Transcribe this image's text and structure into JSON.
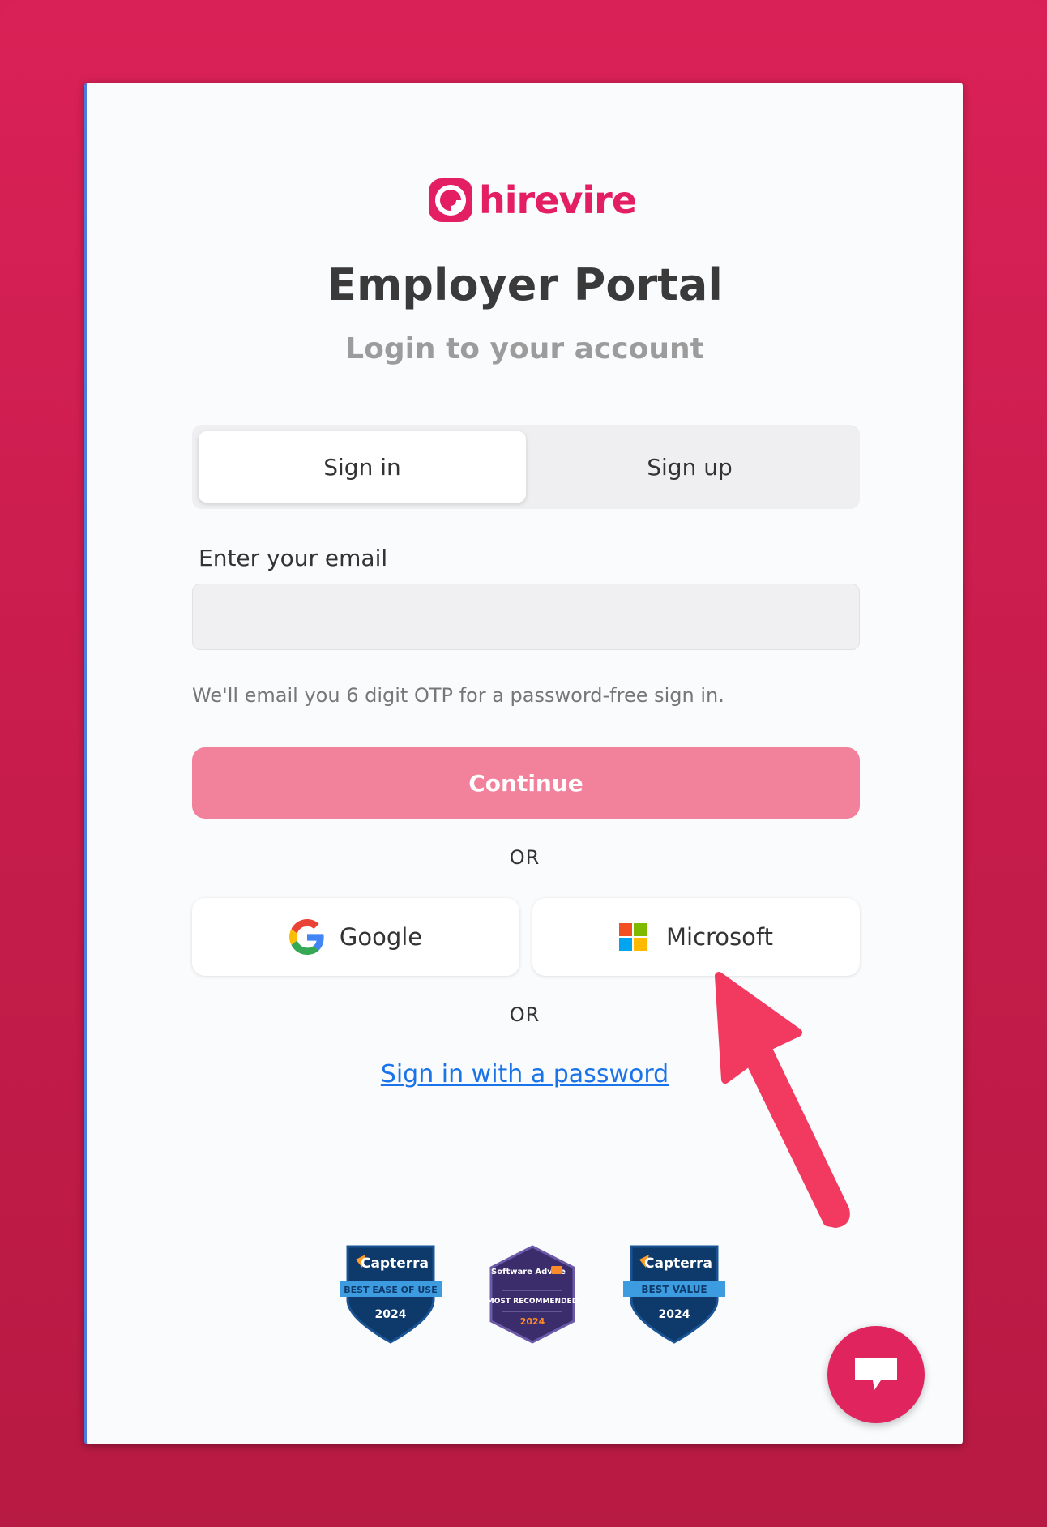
{
  "brand": {
    "name": "hirevire",
    "accent_color": "#e41e63",
    "logo_icon": "hirevire-logo-icon"
  },
  "header": {
    "title": "Employer Portal",
    "subtitle": "Login to your account"
  },
  "tabs": [
    {
      "label": "Sign in",
      "active": true
    },
    {
      "label": "Sign up",
      "active": false
    }
  ],
  "email": {
    "label": "Enter your email",
    "value": "",
    "placeholder": "",
    "hint": "We'll email you 6 digit OTP for a password-free sign in."
  },
  "continue_label": "Continue",
  "divider_text": "OR",
  "sso": {
    "google_label": "Google",
    "google_icon": "google-icon",
    "microsoft_label": "Microsoft",
    "microsoft_icon": "microsoft-icon"
  },
  "password_link": "Sign in with a password",
  "badges": [
    {
      "brand": "Capterra",
      "award": "BEST EASE OF USE",
      "year": "2024"
    },
    {
      "brand": "Software Advice",
      "award": "MOST RECOMMENDED",
      "year": "2024"
    },
    {
      "brand": "Capterra",
      "award": "BEST VALUE",
      "year": "2024"
    }
  ],
  "chat_icon": "chat-bubble-icon",
  "annotation": {
    "icon": "pointer-arrow-icon",
    "color": "#f2395f"
  }
}
